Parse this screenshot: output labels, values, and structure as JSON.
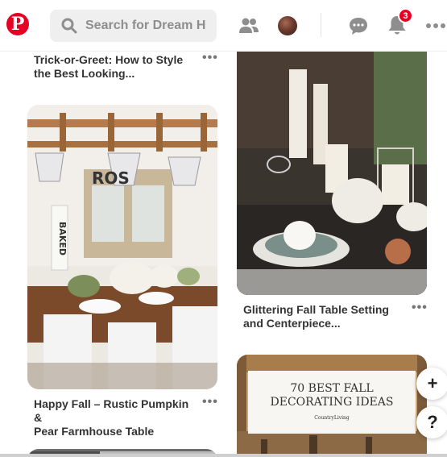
{
  "header": {
    "logo_letter": "P",
    "search_placeholder": "Search for Dream H",
    "notification_count": "3"
  },
  "pins": [
    {
      "title_line1": "Trick-or-Greet: How to Style",
      "title_line2": "the Best Looking..."
    },
    {
      "title_line1": "Happy Fall – Rustic Pumpkin &",
      "title_line2": "Pear Farmhouse Table",
      "sign_text": "ROS",
      "sign2_text": "BAKED"
    },
    {
      "title_line1": "Glittering Fall Table Setting",
      "title_line2": "and Centerpiece..."
    },
    {
      "banner_line1": "70 BEST FALL",
      "banner_line2": "DECORATING IDEAS",
      "banner_brand": "CountryLiving"
    }
  ],
  "more_glyph": "•••",
  "fab": {
    "plus": "+",
    "help": "?"
  },
  "colors": {
    "brand": "#e60023",
    "search_bg": "#efefef"
  }
}
